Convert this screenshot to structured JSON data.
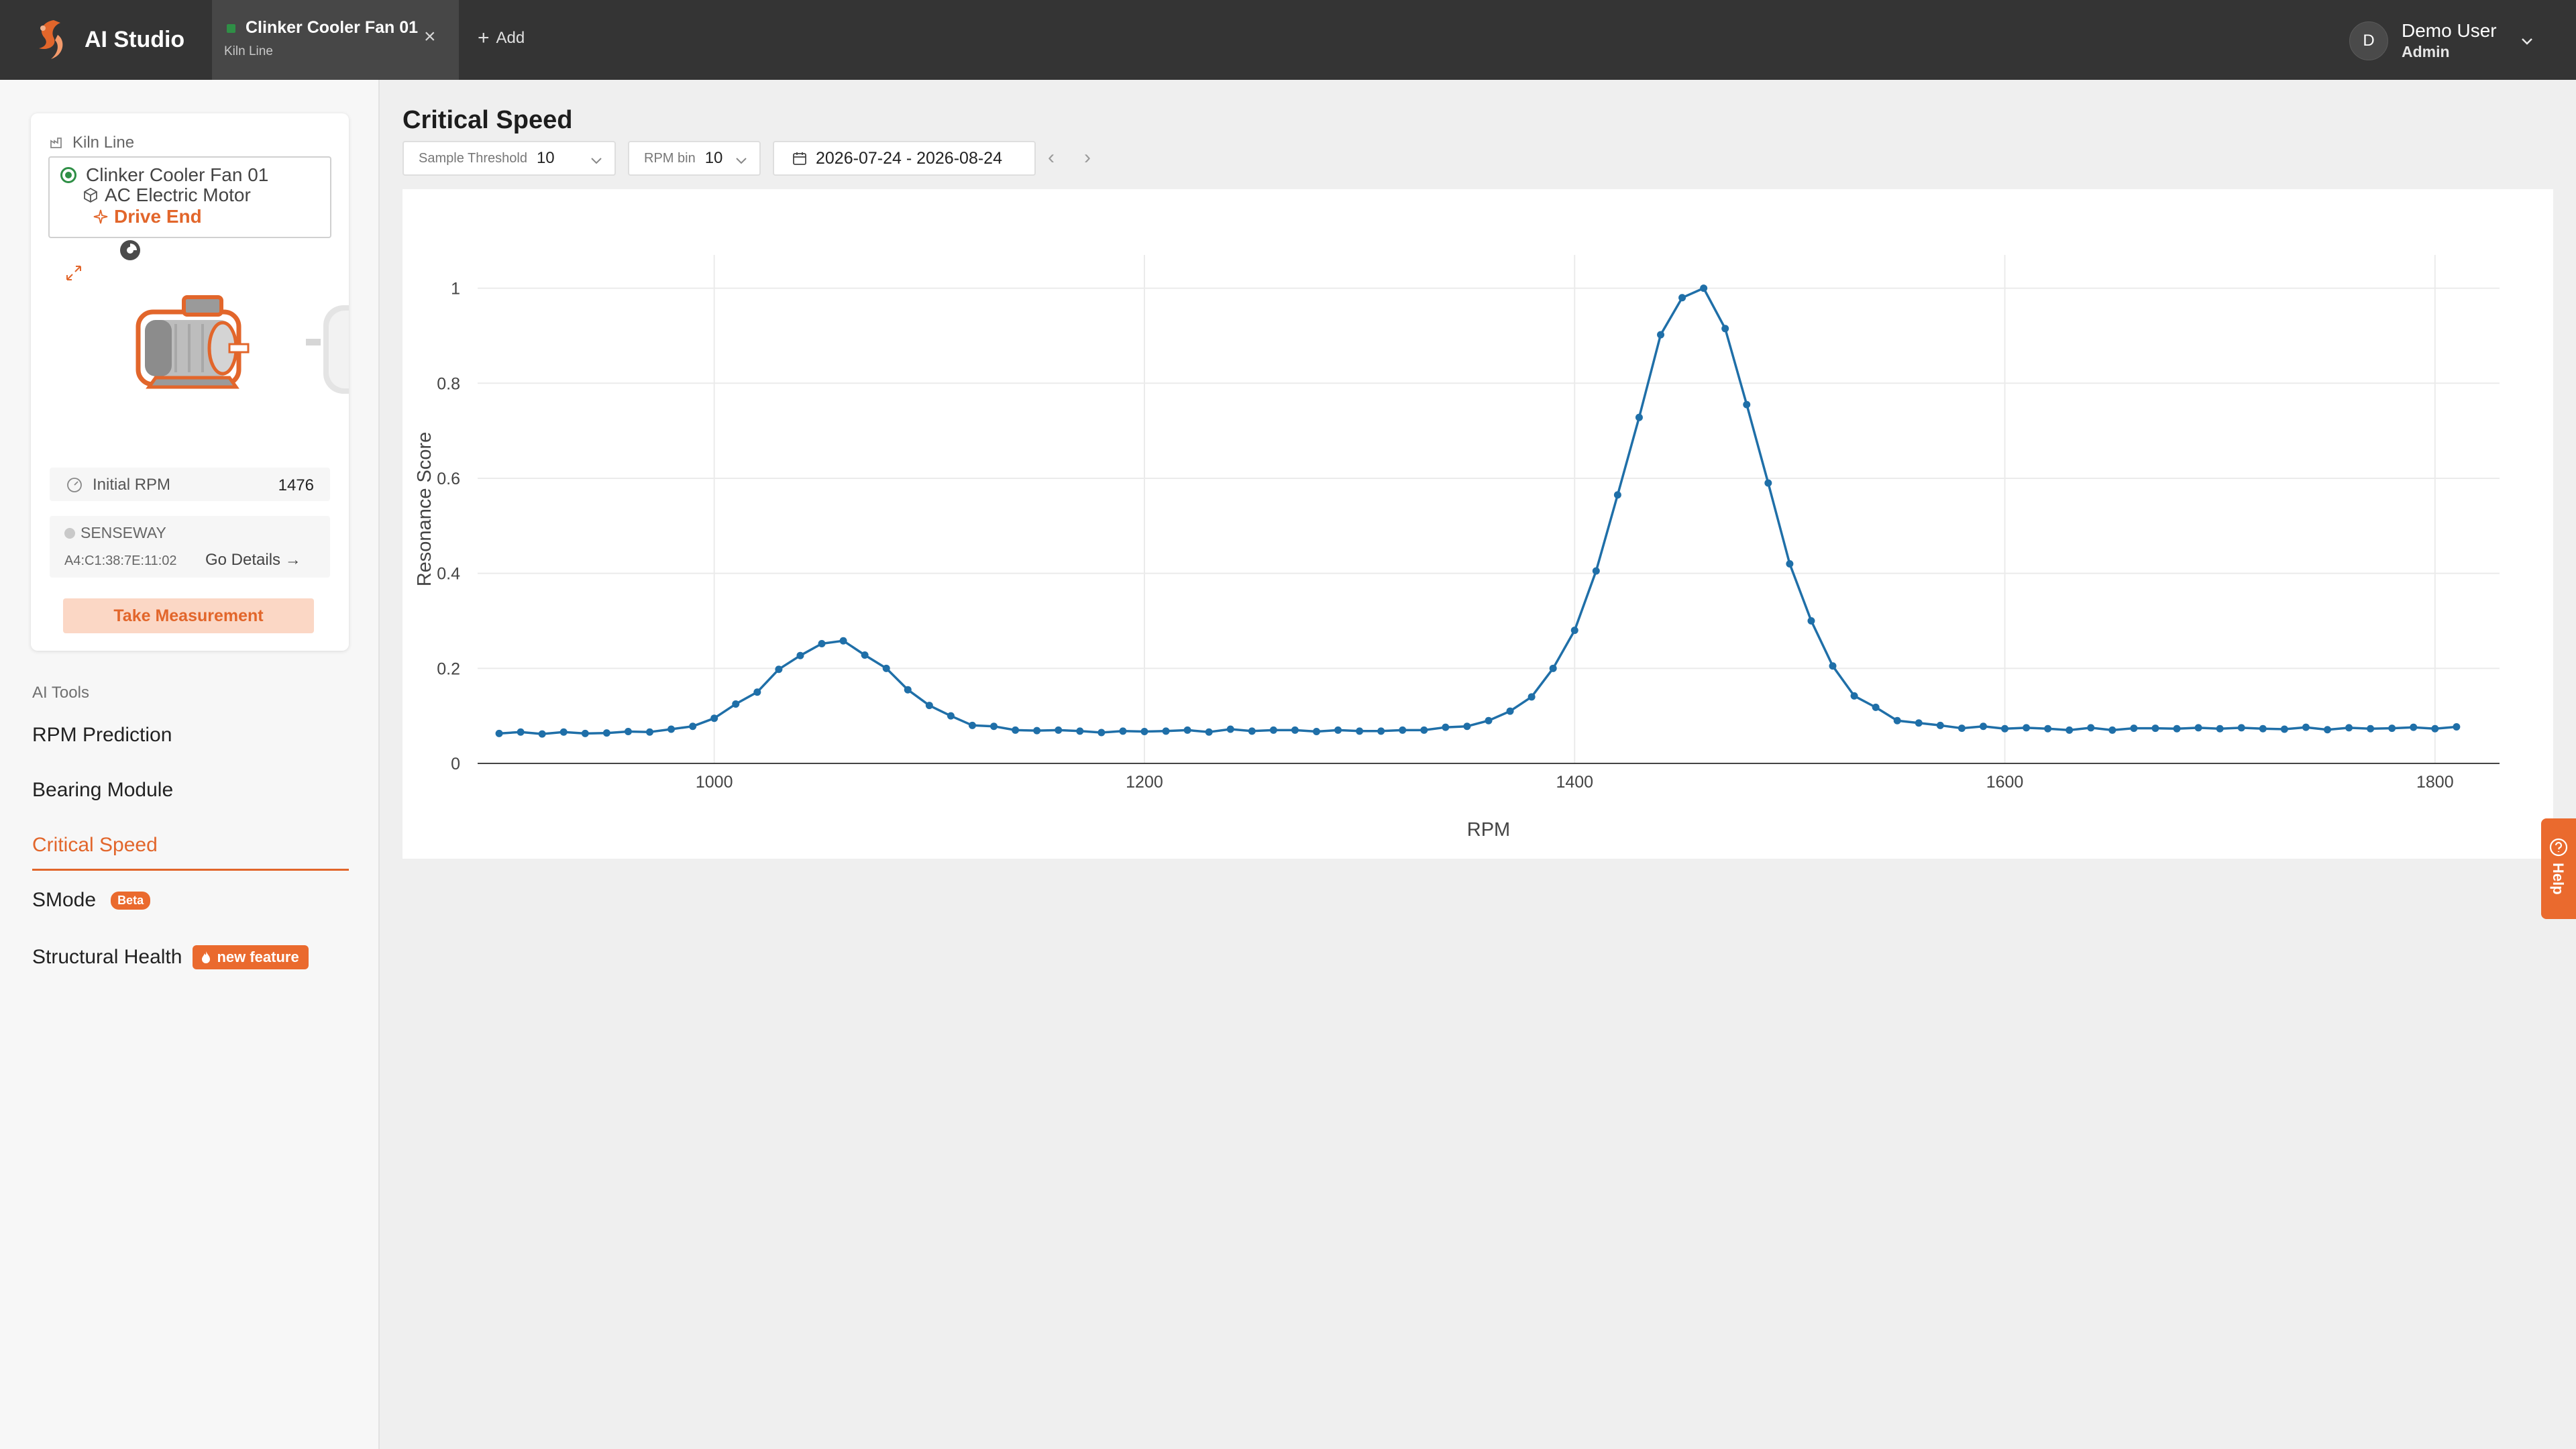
{
  "app": {
    "name": "AI Studio",
    "accent": "#e2662b"
  },
  "tabs": [
    {
      "title": "Clinker Cooler Fan 01",
      "subtitle": "Kiln Line",
      "status_color": "#2f8f46"
    }
  ],
  "add_tab_label": "Add",
  "user": {
    "initial": "D",
    "name": "Demo User",
    "role": "Admin"
  },
  "asset": {
    "site": "Kiln Line",
    "machine": "Clinker Cooler Fan 01",
    "component": "AC Electric Motor",
    "point": "Drive End",
    "initial_rpm_label": "Initial RPM",
    "initial_rpm_value": "1476",
    "sensor_name": "SENSEWAY",
    "sensor_mac": "A4:C1:38:7E:11:02",
    "go_details_label": "Go Details →",
    "take_measurement_label": "Take Measurement"
  },
  "ai_tools": {
    "title": "AI Tools",
    "items": [
      {
        "label": "RPM Prediction"
      },
      {
        "label": "Bearing Module"
      },
      {
        "label": "Critical Speed",
        "active": true
      },
      {
        "label": "SMode",
        "badge": "Beta"
      },
      {
        "label": "Structural Health",
        "badge": "new feature"
      }
    ]
  },
  "page": {
    "title": "Critical Speed",
    "sample_threshold_label": "Sample Threshold",
    "sample_threshold_value": "10",
    "rpm_bin_label": "RPM bin",
    "rpm_bin_value": "10",
    "date_range": "2026-07-24 - 2026-08-24"
  },
  "help_label": "Help",
  "chart_data": {
    "type": "line",
    "xlabel": "RPM",
    "ylabel": "Resonance Score",
    "xlim": [
      890,
      1830
    ],
    "ylim": [
      0,
      1.07
    ],
    "x_ticks": [
      1000,
      1200,
      1400,
      1600,
      1800
    ],
    "y_ticks": [
      0,
      0.2,
      0.4,
      0.6,
      0.8,
      1
    ],
    "grid": true,
    "color": "#1f6fa8",
    "series": [
      {
        "x": [
          900,
          910,
          920,
          930,
          940,
          950,
          960,
          970,
          980,
          990,
          1000,
          1010,
          1020,
          1030,
          1040,
          1050,
          1060,
          1070,
          1080,
          1090,
          1100,
          1110,
          1120,
          1130,
          1140,
          1150,
          1160,
          1170,
          1180,
          1190,
          1200,
          1210,
          1220,
          1230,
          1240,
          1250,
          1260,
          1270,
          1280,
          1290,
          1300,
          1310,
          1320,
          1330,
          1340,
          1350,
          1360,
          1370,
          1380,
          1390,
          1400,
          1410,
          1420,
          1430,
          1440,
          1450,
          1460,
          1470,
          1480,
          1490,
          1500,
          1510,
          1520,
          1530,
          1540,
          1550,
          1560,
          1570,
          1580,
          1590,
          1600,
          1610,
          1620,
          1630,
          1640,
          1650,
          1660,
          1670,
          1680,
          1690,
          1700,
          1710,
          1720,
          1730,
          1740,
          1750,
          1760,
          1770,
          1780,
          1790,
          1800,
          1810
        ],
        "y": [
          0.063,
          0.066,
          0.062,
          0.066,
          0.063,
          0.064,
          0.067,
          0.066,
          0.072,
          0.078,
          0.095,
          0.125,
          0.15,
          0.198,
          0.227,
          0.252,
          0.258,
          0.228,
          0.2,
          0.155,
          0.122,
          0.1,
          0.08,
          0.078,
          0.07,
          0.069,
          0.07,
          0.068,
          0.065,
          0.068,
          0.067,
          0.068,
          0.07,
          0.066,
          0.072,
          0.068,
          0.07,
          0.07,
          0.067,
          0.07,
          0.068,
          0.068,
          0.07,
          0.07,
          0.076,
          0.078,
          0.09,
          0.11,
          0.14,
          0.2,
          0.28,
          0.405,
          0.565,
          0.728,
          0.902,
          0.98,
          1.0,
          0.915,
          0.755,
          0.59,
          0.42,
          0.3,
          0.205,
          0.142,
          0.118,
          0.09,
          0.085,
          0.08,
          0.074,
          0.078,
          0.073,
          0.075,
          0.073,
          0.07,
          0.075,
          0.07,
          0.074,
          0.074,
          0.073,
          0.075,
          0.073,
          0.075,
          0.073,
          0.072,
          0.076,
          0.071,
          0.075,
          0.073,
          0.074,
          0.076,
          0.073,
          0.077
        ]
      }
    ]
  }
}
